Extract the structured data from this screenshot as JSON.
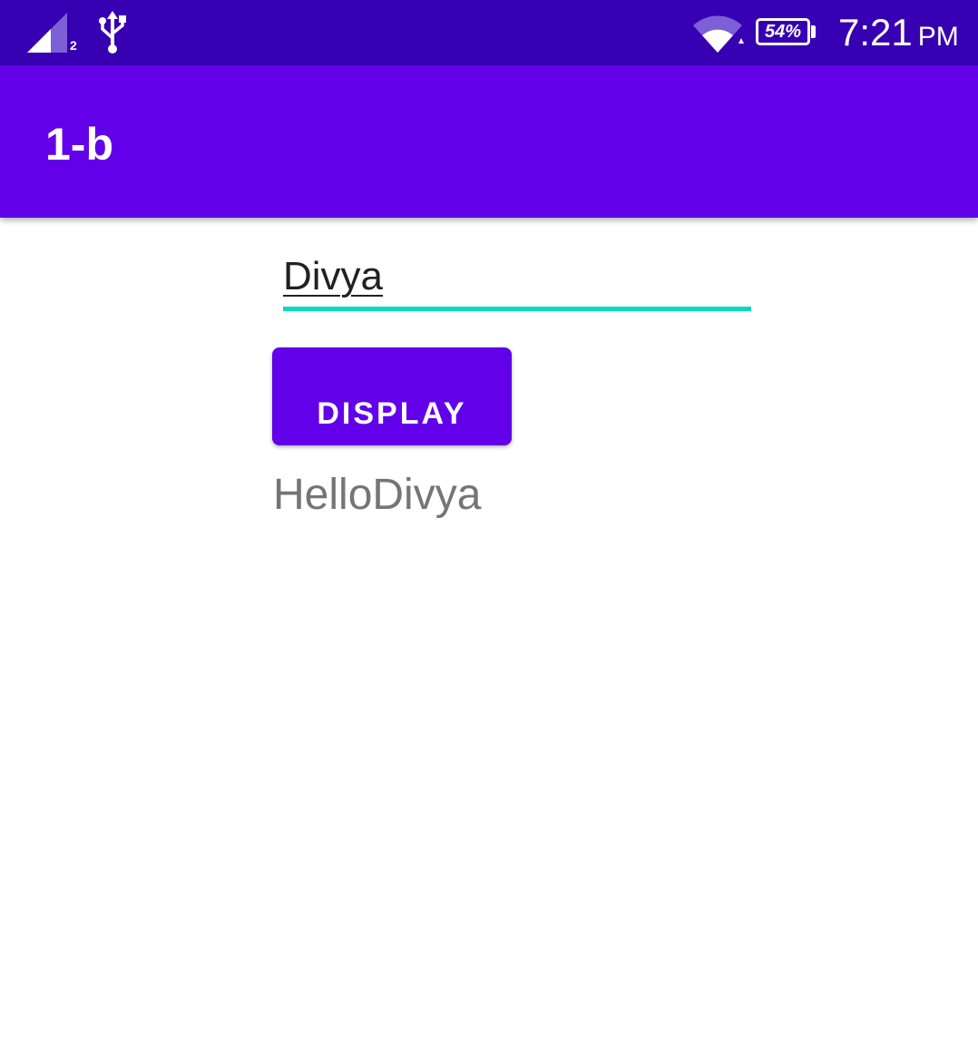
{
  "status_bar": {
    "sim_slot": "2",
    "battery": "54%",
    "time": "7:21",
    "ampm": "PM",
    "colors": {
      "background": "#3700b3"
    },
    "icons": [
      "signal-icon",
      "usb-icon",
      "wifi-icon",
      "battery-icon"
    ]
  },
  "app_bar": {
    "title": "1-b",
    "colors": {
      "background": "#6200ea"
    }
  },
  "form": {
    "name_value": "Divya",
    "underline_color": "#03dac5",
    "button_label": "DISPLAY",
    "button_color": "#6200ea",
    "output": "HelloDivya"
  }
}
